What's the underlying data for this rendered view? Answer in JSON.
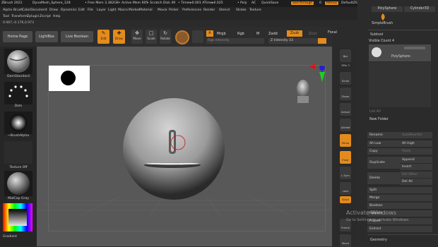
{
  "titlebar": {
    "app": "ZBrush 2021",
    "doc": "DynaMesh_Sphere_128",
    "free_mem": "• Free Mem 3.382GB",
    "active_mem": "• Active Mem 605",
    "scratch": "• Scratch Disk 49",
    "timer": "• Timer▸0.001 ATime▸0.025",
    "poly": "• Poly",
    "ac": "AC",
    "quicksave": "QuickSave",
    "see_through": "See-through",
    "see_through_val": "0",
    "menus": "Menus",
    "default_script": "DefaultZScript",
    "help": "Help"
  },
  "menu_row1": [
    "Alpha",
    "Brush",
    "Color",
    "Document",
    "Draw",
    "Dynamics",
    "Edit",
    "File",
    "Layer",
    "Light",
    "Macro",
    "Marker",
    "Material",
    "Movie",
    "Picker",
    "Preferences",
    "Render",
    "Stencil",
    "Stroke",
    "Texture"
  ],
  "menu_row2": [
    "Tool",
    "Transform",
    "Zplugin",
    "Zscript",
    "Help"
  ],
  "coords": "0.067,-0.176,0.973",
  "toolbar": {
    "home": "Home Page",
    "lightbox": "LightBox",
    "live_boolean": "Live Boolean",
    "edit": "Edit",
    "draw": "Draw",
    "move": "Move",
    "scale": "Scale",
    "rotate": "Rotate",
    "a": "A",
    "mrgb": "Mrgb",
    "rgb": "Rgb",
    "m": "M",
    "zadd": "Zadd",
    "zsub": "Zsub",
    "zcut": "Zcut",
    "rgb_intensity": "Rgb Intensity",
    "z_intensity": "Z Intensity 33",
    "focal": "Focal",
    "draw_size": "Draw"
  },
  "left": {
    "brush": "DamStandard",
    "stroke": "Dots",
    "alpha": "~BrushAlpha",
    "texture": "Texture Off",
    "material": "MatCap Gray",
    "gradient": "Gradient"
  },
  "rtools": [
    "Bpr",
    "SPix 3",
    "Scroll",
    "Zoom",
    "Actual",
    "AAHalf",
    "Persp",
    "Floor",
    "L.Sym",
    "Lock",
    "Qxyz",
    "Frame",
    "Move"
  ],
  "rpanel": {
    "top_tab1": "PolySphere",
    "top_tab2": "Cylinder3D",
    "simplebrush": "SimpleBrush",
    "subtool": "Subtool",
    "visible_count": "Visible Count 4",
    "polysphere": "PolySphere",
    "list_all": "List All",
    "new_folder": "New Folder",
    "rename": "Rename",
    "autoreorder": "AutoReorder",
    "all_low": "All Low",
    "all_high": "All High",
    "copy": "Copy",
    "paste": "Paste",
    "duplicate": "Duplicate",
    "append": "Append",
    "insert": "Insert",
    "delete": "Delete",
    "del_other": "Del Other",
    "del_all": "Del All",
    "split": "Split",
    "merge": "Merge",
    "boolean": "Boolean",
    "remesh": "Remesh",
    "project": "Project",
    "extract": "Extract",
    "geometry": "Geometry"
  },
  "watermark": {
    "title": "Activate Windows",
    "sub": "Go to Settings to activate Windows."
  },
  "colors": {
    "accent": "#e38b1c",
    "canvas": "#585858",
    "panel": "#2b2b2b"
  }
}
